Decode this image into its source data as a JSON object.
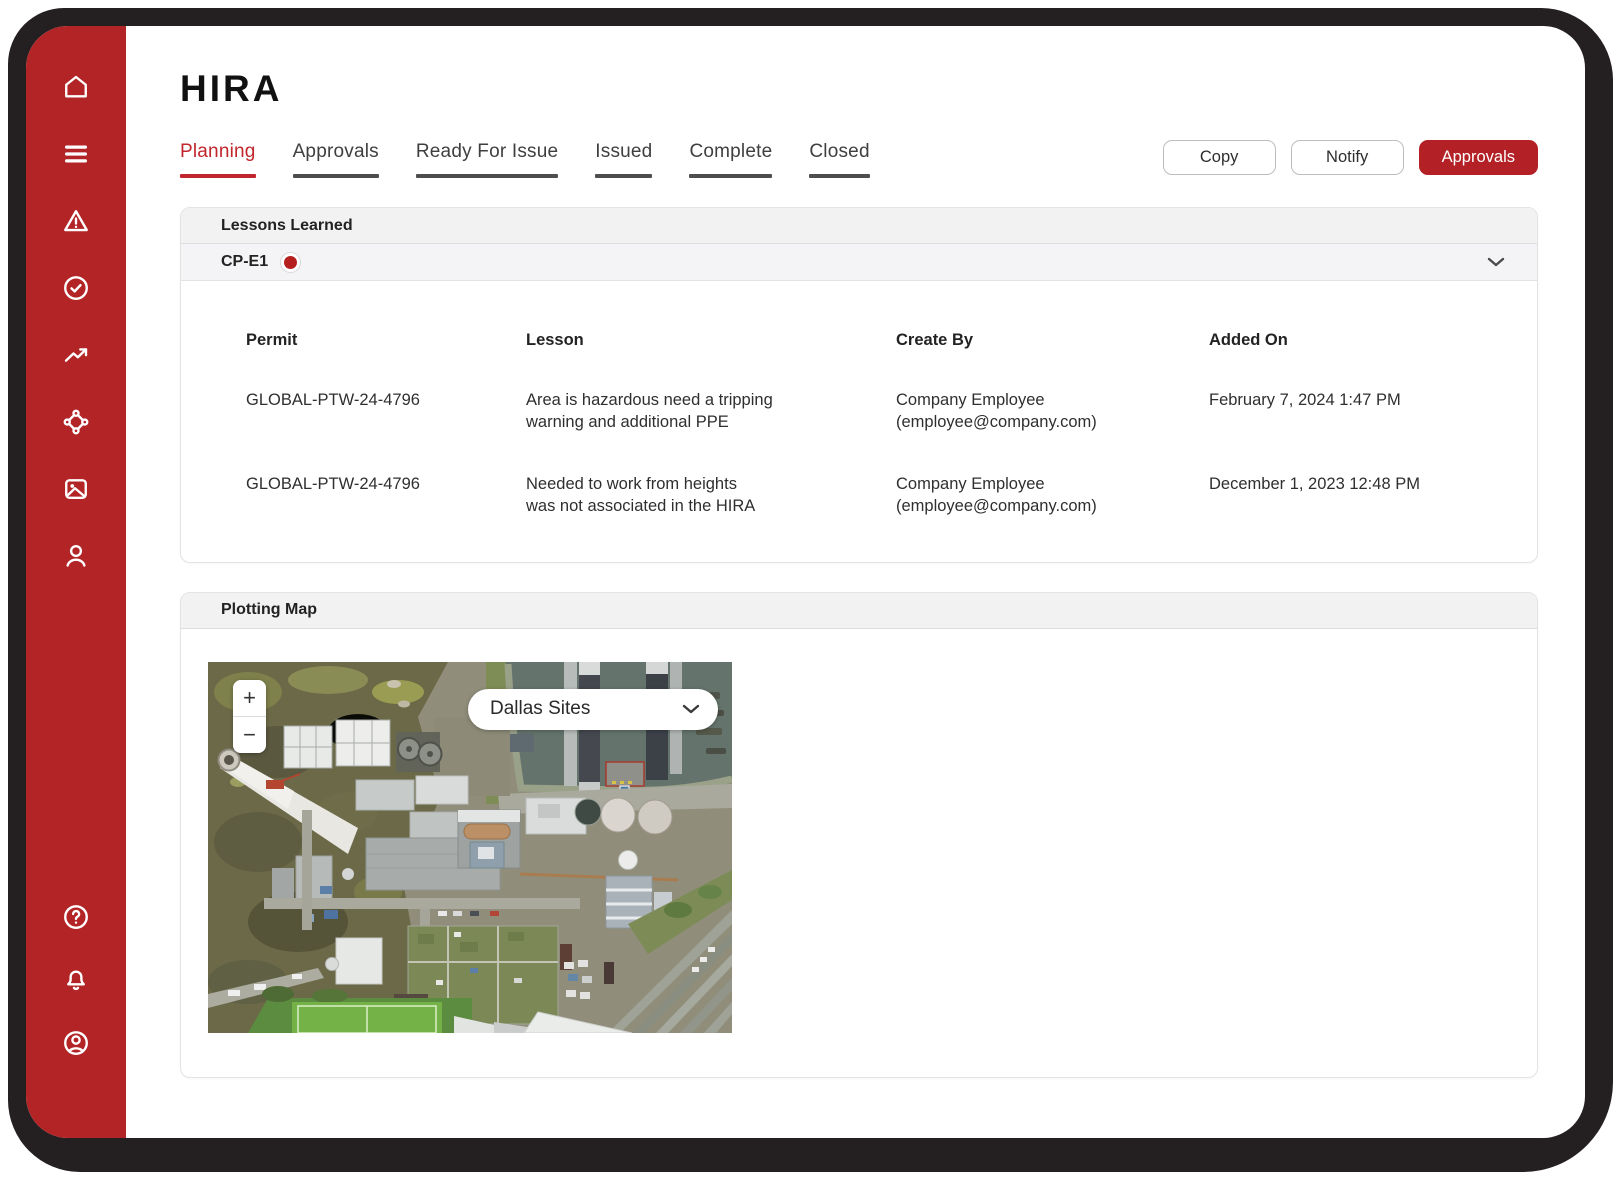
{
  "app": {
    "title": "HIRA"
  },
  "colors": {
    "accent_red": "#B32025",
    "sidebar_red": "#B32427",
    "frame_black": "#241F21",
    "status_dot": "#B5201F"
  },
  "tabs": [
    {
      "label": "Planning",
      "active": true
    },
    {
      "label": "Approvals",
      "active": false
    },
    {
      "label": "Ready For Issue",
      "active": false
    },
    {
      "label": "Issued",
      "active": false
    },
    {
      "label": "Complete",
      "active": false
    },
    {
      "label": "Closed",
      "active": false
    }
  ],
  "actions": {
    "copy": "Copy",
    "notify": "Notify",
    "approvals": "Approvals"
  },
  "lessons": {
    "panel_title": "Lessons Learned",
    "group": {
      "label": "CP-E1"
    },
    "columns": [
      "Permit",
      "Lesson",
      "Create By",
      "Added On"
    ],
    "rows": [
      {
        "permit": "GLOBAL-PTW-24-4796",
        "lesson": "Area is hazardous need a tripping\nwarning and additional PPE",
        "created_by": "Company Employee\n(employee@company.com)",
        "added_on": "February 7, 2024 1:47 PM"
      },
      {
        "permit": "GLOBAL-PTW-24-4796",
        "lesson": "Needed to work from heights\nwas not associated in the HIRA",
        "created_by": "Company Employee\n(employee@company.com)",
        "added_on": "December 1, 2023 12:48 PM"
      }
    ]
  },
  "map": {
    "panel_title": "Plotting Map",
    "dropdown_value": "Dallas Sites",
    "zoom_in": "+",
    "zoom_out": "−"
  },
  "sidebar_icons": {
    "top": [
      "home-icon",
      "menu-icon",
      "warning-icon",
      "check-circle-icon",
      "trending-up-icon",
      "nodes-diamond-icon",
      "image-icon",
      "user-icon"
    ],
    "bottom": [
      "help-icon",
      "bell-icon",
      "account-circle-icon"
    ]
  }
}
